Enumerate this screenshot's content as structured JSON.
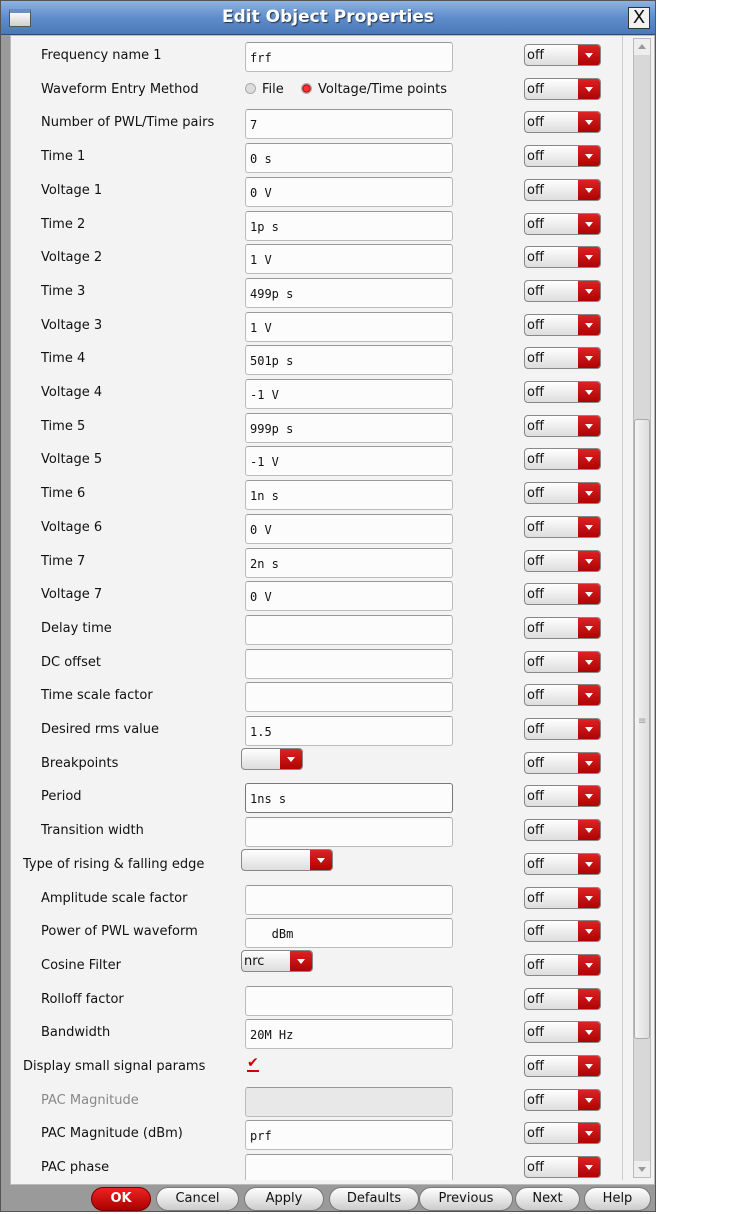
{
  "window": {
    "title": "Edit Object Properties",
    "close": "X"
  },
  "off_value": "off",
  "rows": [
    {
      "label": "Frequency name 1",
      "type": "text",
      "value": "frf"
    },
    {
      "label": "Waveform Entry Method",
      "type": "radio",
      "options": [
        "File",
        "Voltage/Time points"
      ],
      "selected": 1
    },
    {
      "label": "Number of PWL/Time pairs",
      "type": "text",
      "value": "7"
    },
    {
      "label": "Time 1",
      "type": "text",
      "value": "0 s"
    },
    {
      "label": "Voltage 1",
      "type": "text",
      "value": "0 V"
    },
    {
      "label": "Time 2",
      "type": "text",
      "value": "1p s"
    },
    {
      "label": "Voltage 2",
      "type": "text",
      "value": "1 V"
    },
    {
      "label": "Time 3",
      "type": "text",
      "value": "499p s"
    },
    {
      "label": "Voltage 3",
      "type": "text",
      "value": "1 V"
    },
    {
      "label": "Time 4",
      "type": "text",
      "value": "501p s"
    },
    {
      "label": "Voltage 4",
      "type": "text",
      "value": "-1 V"
    },
    {
      "label": "Time 5",
      "type": "text",
      "value": "999p s"
    },
    {
      "label": "Voltage 5",
      "type": "text",
      "value": "-1 V"
    },
    {
      "label": "Time 6",
      "type": "text",
      "value": "1n s"
    },
    {
      "label": "Voltage 6",
      "type": "text",
      "value": "0 V"
    },
    {
      "label": "Time 7",
      "type": "text",
      "value": "2n s"
    },
    {
      "label": "Voltage 7",
      "type": "text",
      "value": "0 V"
    },
    {
      "label": "Delay time",
      "type": "text",
      "value": ""
    },
    {
      "label": "DC offset",
      "type": "text",
      "value": ""
    },
    {
      "label": "Time scale factor",
      "type": "text",
      "value": ""
    },
    {
      "label": "Desired rms value",
      "type": "text",
      "value": "1.5"
    },
    {
      "label": "Breakpoints",
      "type": "combo",
      "value": "",
      "w": 62
    },
    {
      "label": "Period",
      "type": "text",
      "value": "1ns s",
      "focus": true
    },
    {
      "label": "Transition width",
      "type": "text",
      "value": ""
    },
    {
      "label": "Type of rising & falling edge",
      "type": "combo",
      "value": "",
      "w": 92,
      "outdent": true
    },
    {
      "label": "Amplitude scale factor",
      "type": "text",
      "value": ""
    },
    {
      "label": "Power of PWL waveform",
      "type": "text",
      "value": "   dBm"
    },
    {
      "label": "Cosine Filter",
      "type": "combo",
      "value": "nrc",
      "w": 72
    },
    {
      "label": "Rolloff factor",
      "type": "text",
      "value": ""
    },
    {
      "label": "Bandwidth",
      "type": "text",
      "value": "20M Hz"
    },
    {
      "label": "Display small signal params",
      "type": "check",
      "checked": true,
      "outdent": true
    },
    {
      "label": "PAC Magnitude",
      "type": "text",
      "value": "",
      "disabled": true
    },
    {
      "label": "PAC Magnitude (dBm)",
      "type": "text",
      "value": "prf"
    },
    {
      "label": "PAC phase",
      "type": "text",
      "value": ""
    }
  ],
  "buttons": [
    {
      "id": "ok",
      "label": "OK"
    },
    {
      "id": "cancel",
      "label": "Cancel"
    },
    {
      "id": "apply",
      "label": "Apply"
    },
    {
      "id": "defaults",
      "label": "Defaults"
    },
    {
      "id": "previous",
      "label": "Previous"
    },
    {
      "id": "next",
      "label": "Next"
    },
    {
      "id": "help",
      "label": "Help"
    }
  ]
}
